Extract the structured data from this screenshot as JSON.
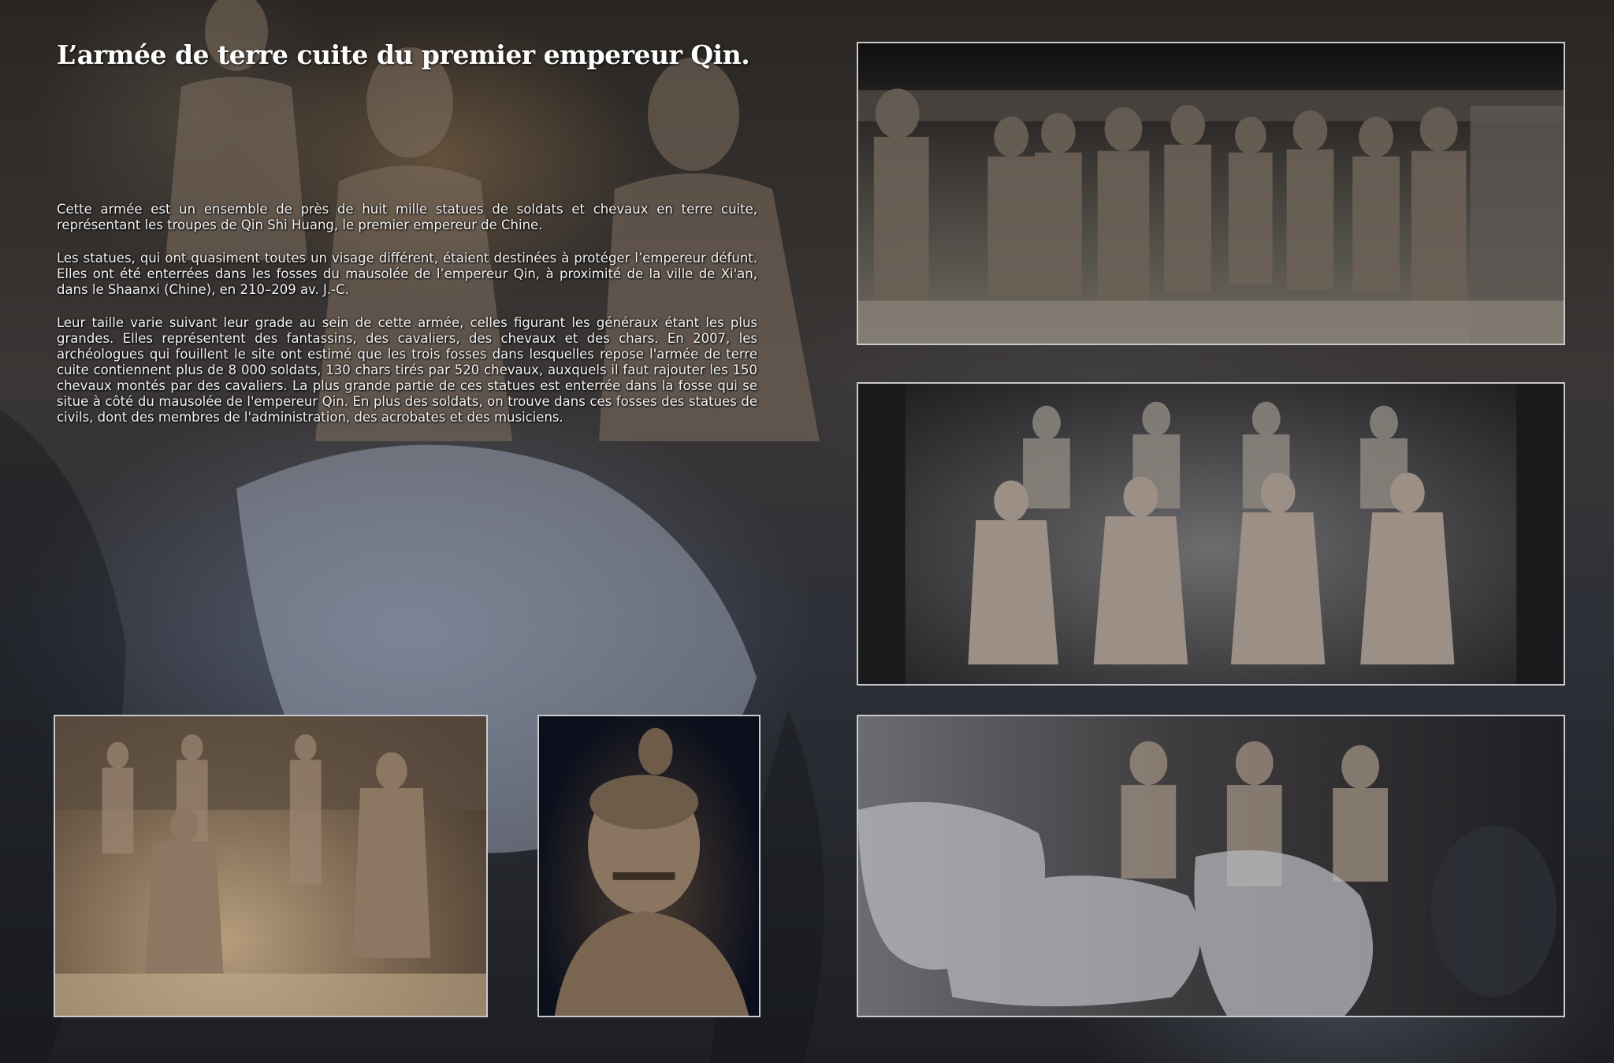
{
  "page": {
    "title": "L’armée de terre cuite du premier empereur Qin.",
    "paragraphs": [
      "Cette armée est un ensemble de près de huit mille statues de soldats et chevaux en terre cuite, représentant les troupes de Qin Shi Huang, le premier empereur de Chine.",
      "Les statues, qui ont quasiment toutes un visage différent, étaient destinées à protéger l’empereur défunt. Elles ont été enterrées dans les fosses du mausolée de l’empereur Qin, à proximité de la ville de Xi'an, dans le Shaanxi (Chine), en 210–209 av. J.-C.",
      "Leur taille varie suivant leur grade au sein de cette armée, celles figurant les généraux étant les plus grandes. Elles représentent des fantassins, des cavaliers, des chevaux et des chars. En 2007, les archéologues qui fouillent le site ont estimé que les trois fosses dans lesquelles repose l'armée de terre cuite contiennent plus de 8 000 soldats, 130 chars tirés par 520 chevaux, auxquels il faut rajouter les 150 chevaux montés par des cavaliers. La plus grande partie de ces statues est enterrée dans la fosse qui se situe à côté du mausolée de l'empereur Qin. En plus des soldats, on trouve dans ces fosses des statues de civils, dont des membres de l'administration, des acrobates et des musiciens."
    ]
  },
  "colors": {
    "frame": "#c9c9c9",
    "terracotta": "#8a7a68",
    "title_text": "#ffffff"
  },
  "photos": [
    {
      "subject": "standing-soldiers-rows"
    },
    {
      "subject": "kneeling-archers"
    },
    {
      "subject": "horses-and-soldiers"
    },
    {
      "subject": "soldiers-on-sand"
    },
    {
      "subject": "soldier-head-portrait"
    }
  ]
}
